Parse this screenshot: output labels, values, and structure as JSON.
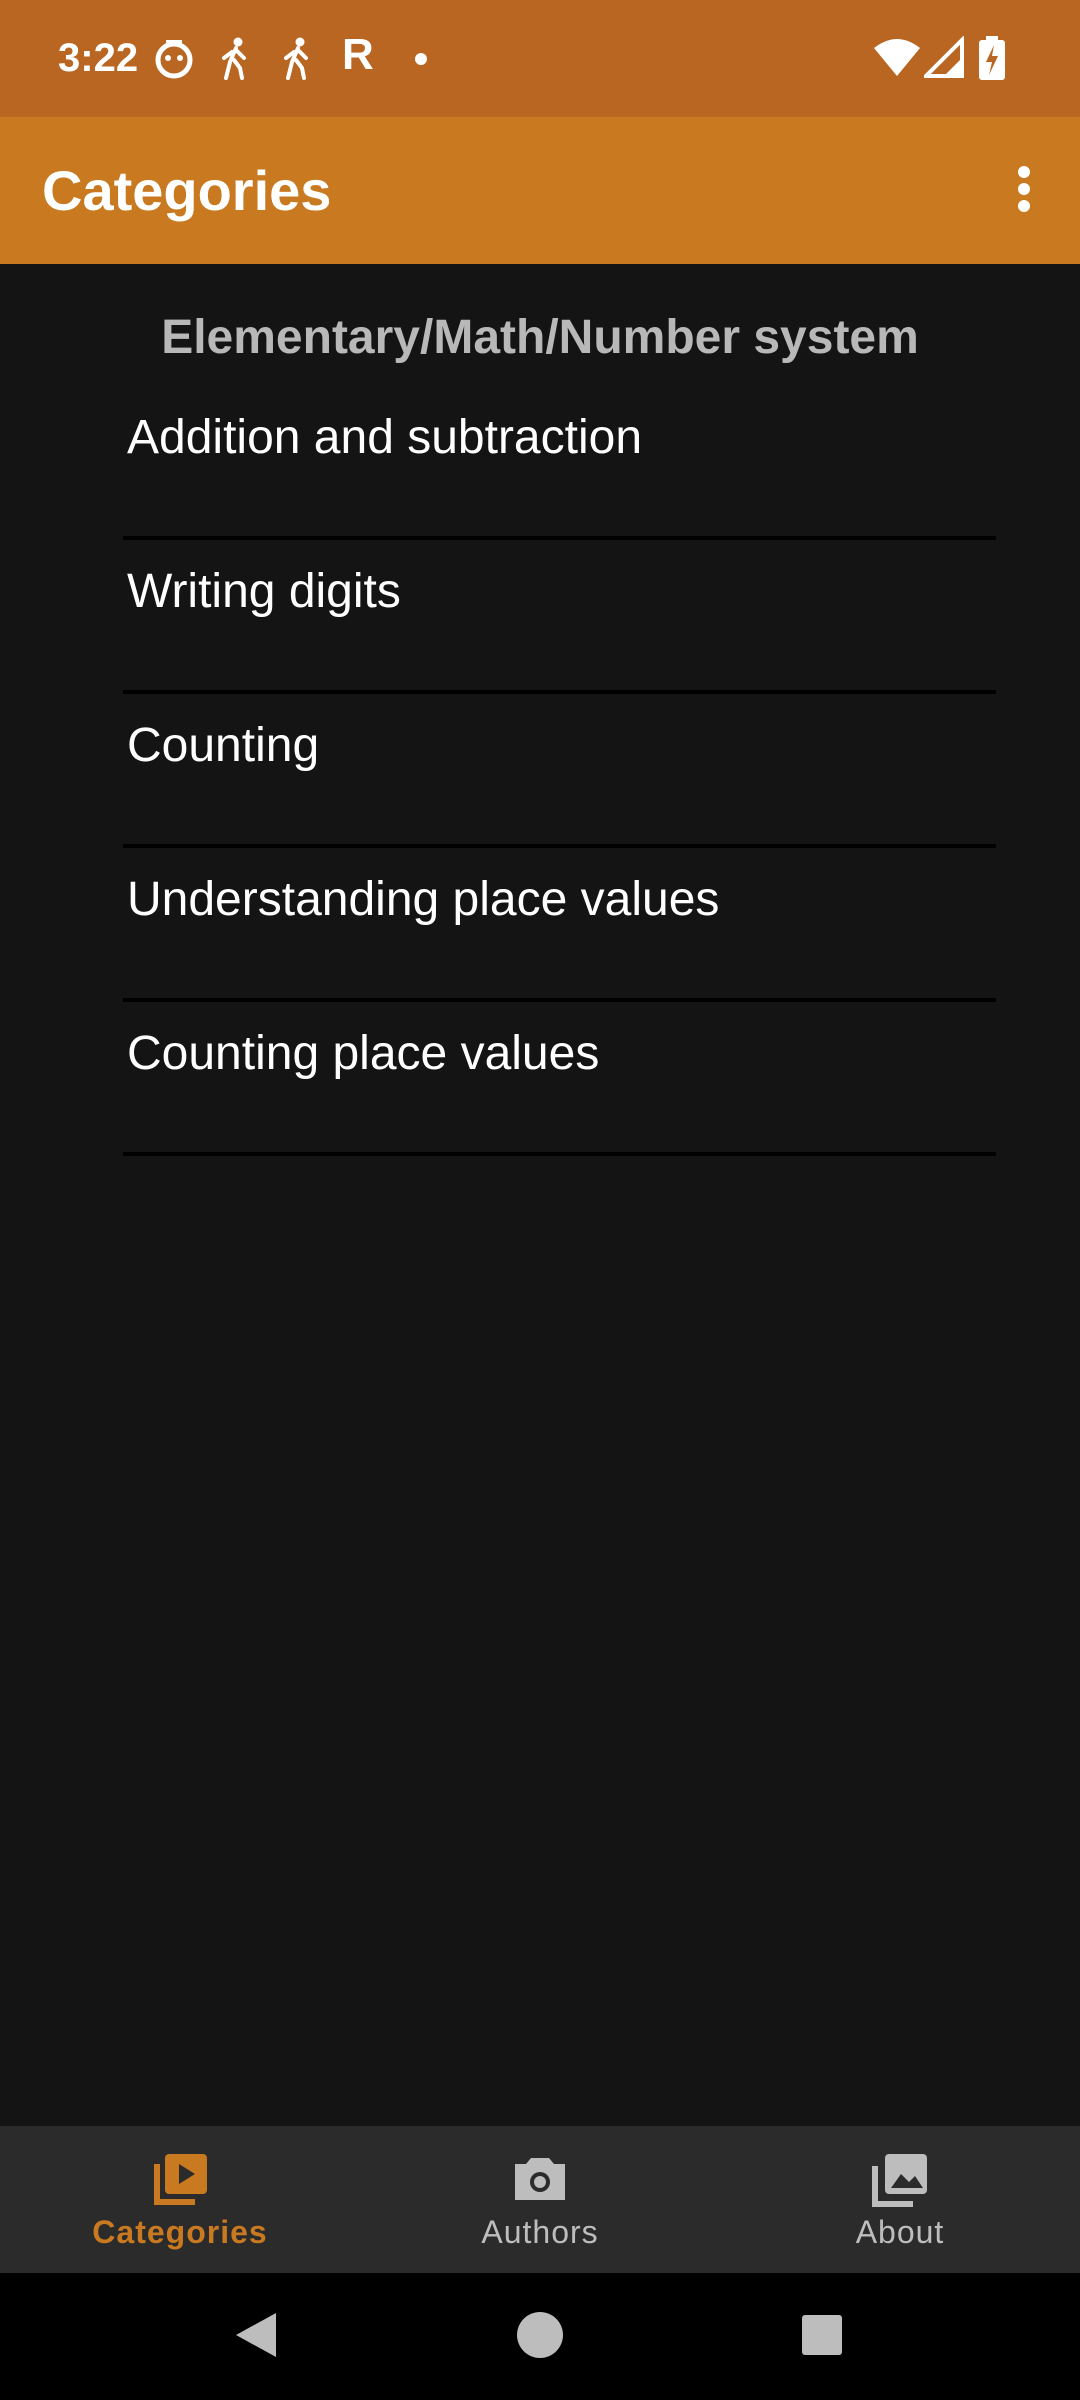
{
  "status_bar": {
    "time": "3:22",
    "left_icons": [
      "face-icon",
      "walking-icon",
      "walking-icon",
      "r-icon",
      "dot-icon"
    ],
    "r_glyph": "R",
    "right_icons": [
      "wifi-icon",
      "signal-icon",
      "battery-charging-icon"
    ]
  },
  "app_bar": {
    "title": "Categories",
    "menu_icon": "more-vert-icon"
  },
  "content": {
    "breadcrumb": "Elementary/Math/Number system",
    "items": [
      {
        "label": "Addition and subtraction"
      },
      {
        "label": "Writing digits"
      },
      {
        "label": "Counting"
      },
      {
        "label": "Understanding place values"
      },
      {
        "label": "Counting place values"
      }
    ]
  },
  "bottom_nav": {
    "items": [
      {
        "label": "Categories",
        "icon": "video-library-icon",
        "active": true
      },
      {
        "label": "Authors",
        "icon": "camera-icon",
        "active": false
      },
      {
        "label": "About",
        "icon": "photo-library-icon",
        "active": false
      }
    ]
  },
  "colors": {
    "status_bar": "#b86621",
    "app_bar": "#c97a20",
    "background": "#141414",
    "accent": "#c97a20",
    "nav_background": "#2b2b2b"
  },
  "system_nav": {
    "buttons": [
      "back-icon",
      "home-icon",
      "recents-icon"
    ]
  }
}
